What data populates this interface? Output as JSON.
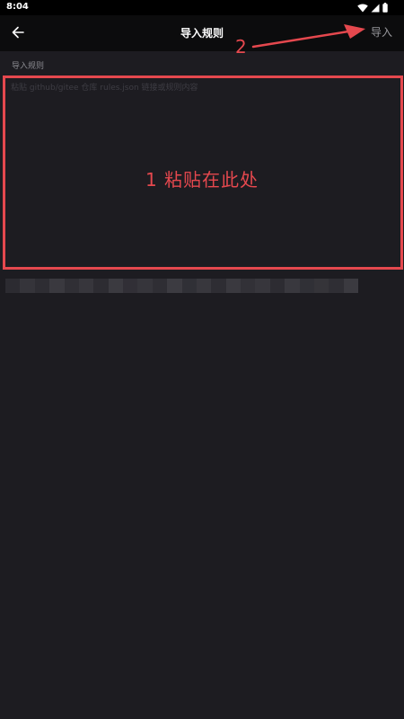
{
  "status_bar": {
    "time": "8:04",
    "icons": [
      "wifi-icon",
      "cellular-signal-icon",
      "battery-icon"
    ]
  },
  "app_bar": {
    "title": "导入规则",
    "back_icon": "arrow-left-icon",
    "action_label": "导入"
  },
  "form": {
    "field_label": "导入规则",
    "input_value": "",
    "input_placeholder": "粘贴 github/gitee 仓库 rules.json 链接或规则内容"
  },
  "annotations": {
    "step1": "1   粘贴在此处",
    "step2": "2",
    "color": "#e5484e"
  },
  "colors": {
    "background": "#1d1c21",
    "app_bar": "#0c0c0d",
    "status_bar": "#000000",
    "muted_text": "#9a9a9e"
  }
}
